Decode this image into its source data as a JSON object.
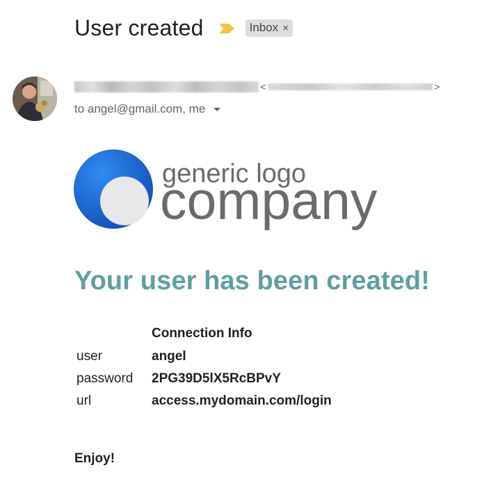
{
  "email": {
    "subject": "User created",
    "label": "Inbox",
    "label_remove_symbol": "×",
    "sender_open_bracket": "<",
    "sender_close_bracket": ">",
    "recipients": "to angel@gmail.com, me"
  },
  "logo": {
    "line1": "generic logo",
    "line2": "company"
  },
  "body": {
    "headline": "Your user has been created!",
    "connection_heading": "Connection Info",
    "rows": [
      {
        "key": "user",
        "value": "angel"
      },
      {
        "key": "password",
        "value": "2PG39D5lX5RcBPvY"
      },
      {
        "key": "url",
        "value": "access.mydomain.com/login"
      }
    ],
    "closing": "Enjoy!"
  },
  "colors": {
    "headline": "#5f9ea0",
    "importance_marker": "#f6c344",
    "logo_blue": "#1e6fd9",
    "logo_text": "#6b6b6b"
  },
  "icons": {
    "importance": "importance-marker-icon",
    "label_remove": "close-icon",
    "details": "chevron-down-icon"
  }
}
